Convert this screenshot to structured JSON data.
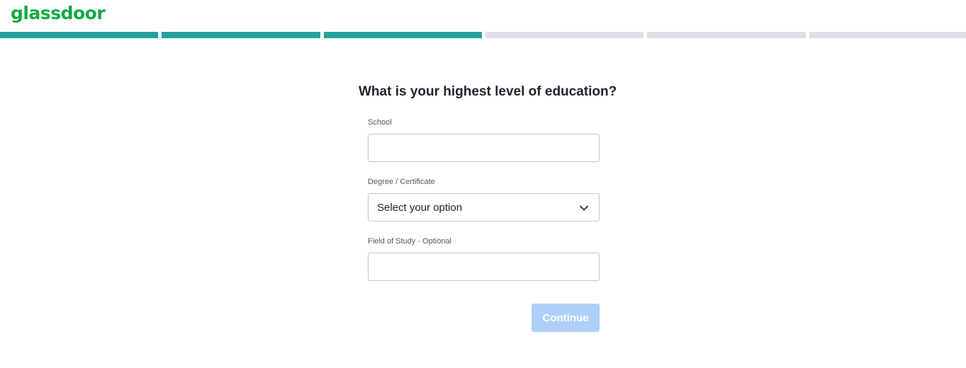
{
  "header": {
    "logo_text": "glassdoor"
  },
  "progress": {
    "total_steps": 6,
    "completed_steps": 3,
    "done_color": "#20a39e",
    "todo_color": "#dedfe3"
  },
  "form": {
    "question": "What is your highest level of education?",
    "school": {
      "label": "School",
      "value": "",
      "placeholder": ""
    },
    "degree": {
      "label": "Degree / Certificate",
      "selected": "Select your option",
      "icon": "chevron-down-icon"
    },
    "field_of_study": {
      "label": "Field of Study - Optional",
      "value": "",
      "placeholder": ""
    },
    "continue_label": "Continue",
    "continue_enabled": false
  },
  "colors": {
    "brand": "#0caa41",
    "button_disabled": "#aecff7"
  }
}
